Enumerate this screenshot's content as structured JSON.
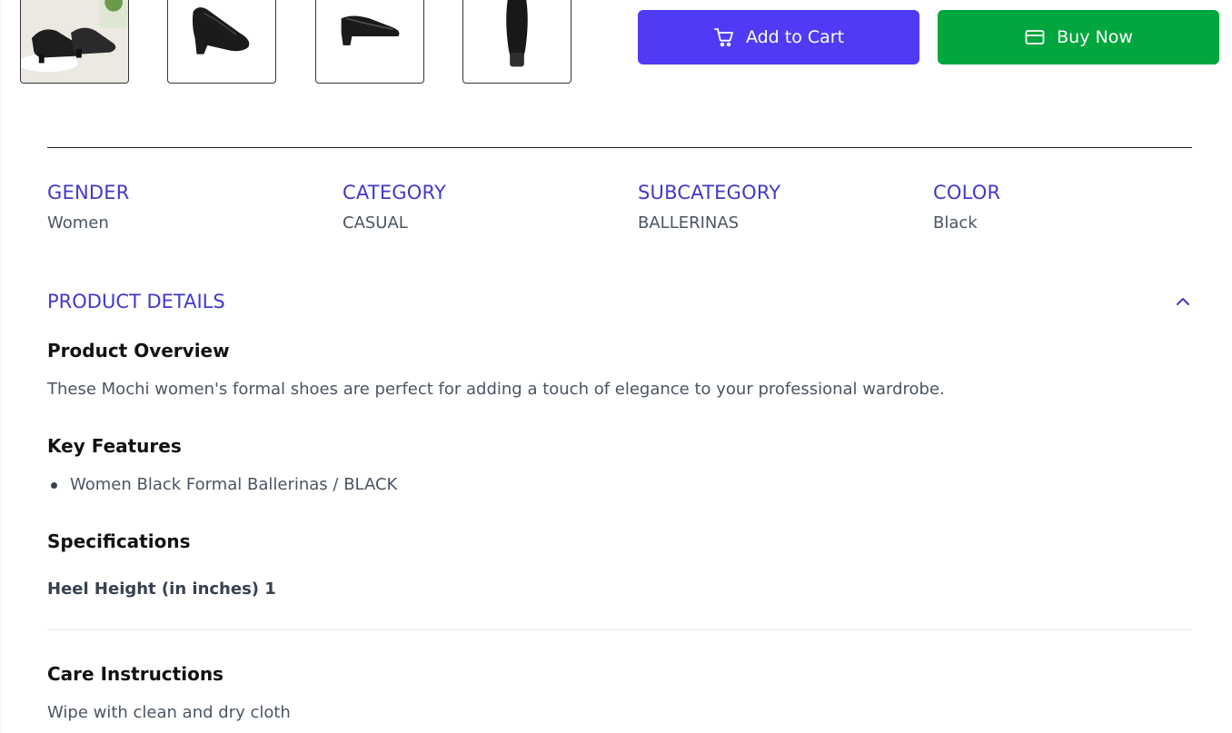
{
  "gallery": {
    "thumbnails": [
      {
        "alt": "shoe-pair-lifestyle"
      },
      {
        "alt": "shoe-side-view"
      },
      {
        "alt": "shoe-profile-view"
      },
      {
        "alt": "shoe-sole-view"
      }
    ]
  },
  "actions": {
    "add_to_cart_label": "Add to Cart",
    "buy_now_label": "Buy Now",
    "add_to_cart_color": "#4f3bf5",
    "buy_now_color": "#00a63e",
    "add_to_cart_icon": "cart-icon",
    "buy_now_icon": "credit-card-icon"
  },
  "attributes": [
    {
      "label": "GENDER",
      "value": "Women"
    },
    {
      "label": "CATEGORY",
      "value": "CASUAL"
    },
    {
      "label": "SUBCATEGORY",
      "value": "BALLERINAS"
    },
    {
      "label": "COLOR",
      "value": "Black"
    }
  ],
  "product_details": {
    "heading": "PRODUCT DETAILS",
    "toggle_icon": "chevron-up-icon",
    "overview_title": "Product Overview",
    "overview_text": "These Mochi women's formal shoes are perfect for adding a touch of elegance to your professional wardrobe.",
    "features_title": "Key Features",
    "features": [
      "Women Black Formal Ballerinas / BLACK"
    ],
    "specifications_title": "Specifications",
    "specifications": [
      "Heel Height (in inches) 1"
    ],
    "care_title": "Care Instructions",
    "care_text": "Wipe with clean and dry cloth"
  },
  "colors": {
    "accent": "#4338ca",
    "text_muted": "#4b5563"
  }
}
